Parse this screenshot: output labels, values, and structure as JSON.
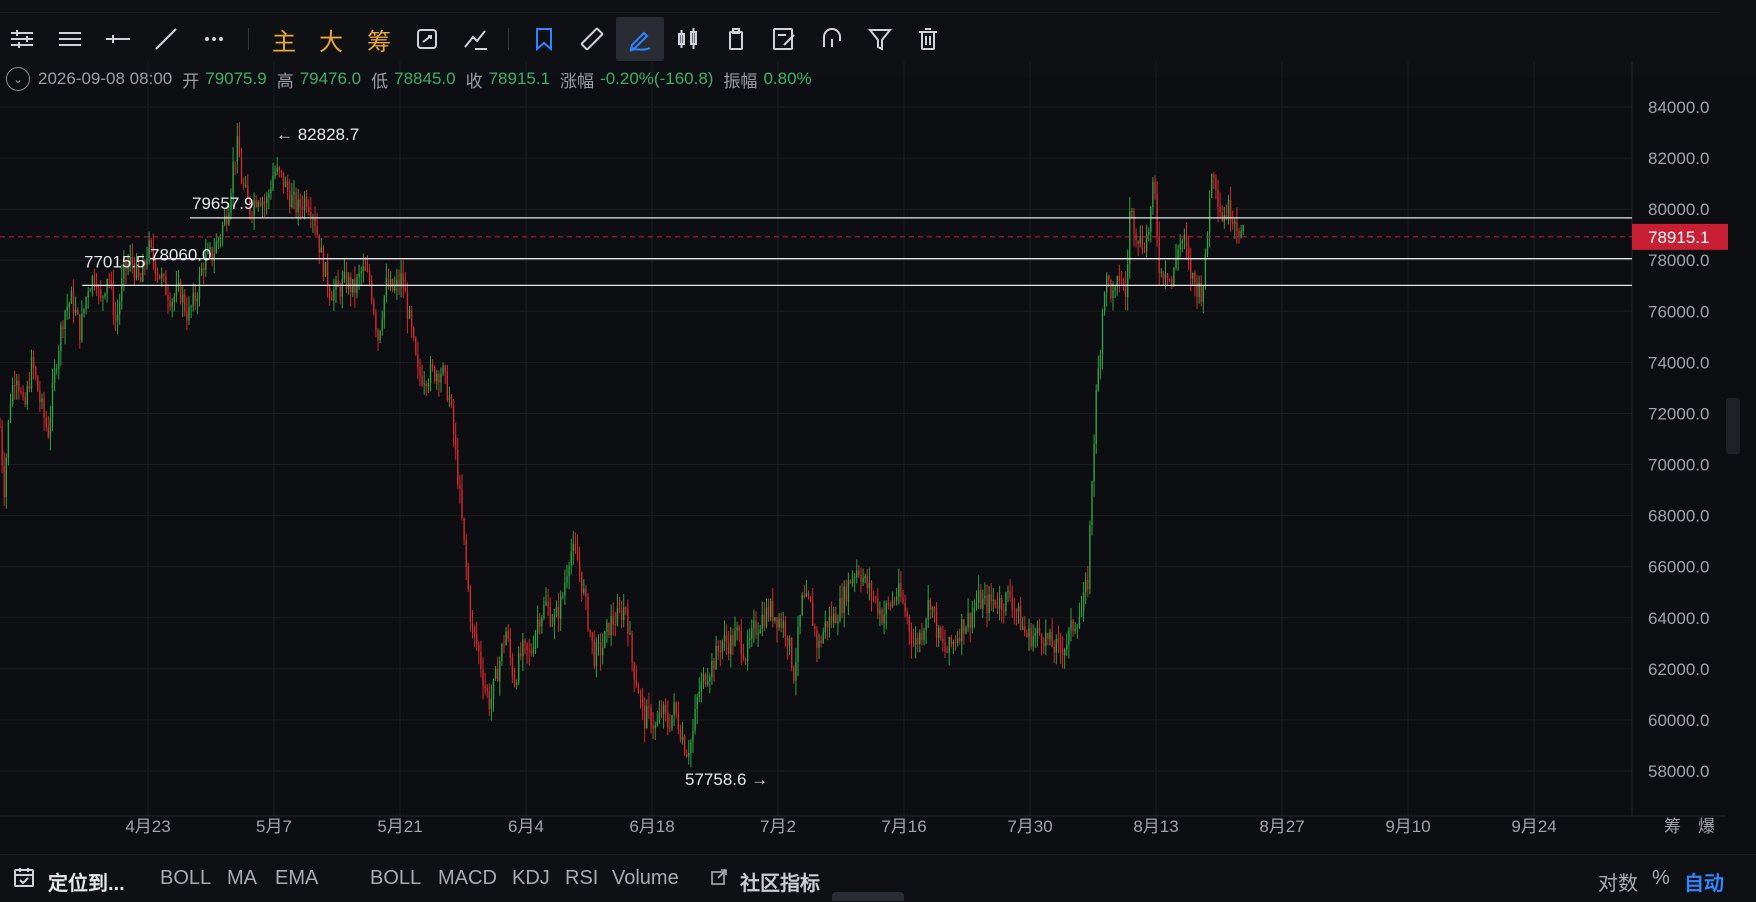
{
  "toolbar": {
    "buttons": [
      {
        "name": "settings-lines-icon"
      },
      {
        "name": "menu-lines-icon"
      },
      {
        "name": "horizontal-line-icon"
      },
      {
        "name": "trend-line-icon"
      },
      {
        "name": "more-dots-icon"
      },
      {
        "label": "主"
      },
      {
        "label": "大"
      },
      {
        "label": "筹"
      },
      {
        "name": "refresh-icon"
      },
      {
        "name": "draw-tools-icon"
      },
      {
        "name": "bookmark-icon"
      },
      {
        "name": "ruler-icon"
      },
      {
        "name": "pen-draw-icon"
      },
      {
        "name": "candles-icon"
      },
      {
        "name": "clipboard-icon"
      },
      {
        "name": "edit-note-icon"
      },
      {
        "name": "magnet-icon"
      },
      {
        "name": "filter-icon"
      },
      {
        "name": "trash-icon"
      }
    ]
  },
  "ohlc": {
    "date": "2026-09-08 08:00",
    "open_label": "开",
    "open": "79075.9",
    "high_label": "高",
    "high": "79476.0",
    "low_label": "低",
    "low": "78845.0",
    "close_label": "收",
    "close": "78915.1",
    "change_label": "涨幅",
    "change": "-0.20%(-160.8)",
    "amp_label": "振幅",
    "amp": "0.80%"
  },
  "chart_data": {
    "type": "candlestick",
    "ylim": [
      57000,
      85000
    ],
    "y_ticks": [
      "84000.0",
      "82000.0",
      "80000.0",
      "78000.0",
      "76000.0",
      "74000.0",
      "72000.0",
      "70000.0",
      "68000.0",
      "66000.0",
      "64000.0",
      "62000.0",
      "60000.0",
      "58000.0"
    ],
    "x_ticks": [
      "4月23",
      "5月7",
      "5月21",
      "6月4",
      "6月18",
      "7月2",
      "7月16",
      "7月30",
      "8月13",
      "8月27",
      "9月10",
      "9月24"
    ],
    "axis_right_extra": [
      "筹",
      "爆"
    ],
    "price_path": [
      [
        0,
        71.5
      ],
      [
        4,
        69
      ],
      [
        10,
        72.5
      ],
      [
        16,
        73.8
      ],
      [
        24,
        72
      ],
      [
        32,
        74
      ],
      [
        40,
        72.5
      ],
      [
        48,
        71.2
      ],
      [
        56,
        74
      ],
      [
        64,
        76
      ],
      [
        72,
        76.5
      ],
      [
        80,
        75.2
      ],
      [
        88,
        77
      ],
      [
        96,
        77.5
      ],
      [
        100,
        76.2
      ],
      [
        108,
        77.6
      ],
      [
        116,
        75.5
      ],
      [
        124,
        77.6
      ],
      [
        132,
        78
      ],
      [
        140,
        77
      ],
      [
        148,
        78.5
      ],
      [
        156,
        77.8
      ],
      [
        164,
        77
      ],
      [
        172,
        76.5
      ],
      [
        180,
        76.8
      ],
      [
        188,
        75.8
      ],
      [
        196,
        76.6
      ],
      [
        204,
        78
      ],
      [
        212,
        78.2
      ],
      [
        220,
        79
      ],
      [
        228,
        80
      ],
      [
        234,
        82
      ],
      [
        238,
        82.5
      ],
      [
        242,
        81
      ],
      [
        250,
        80
      ],
      [
        258,
        80.6
      ],
      [
        266,
        80.2
      ],
      [
        274,
        81.5
      ],
      [
        282,
        81.2
      ],
      [
        290,
        80.5
      ],
      [
        298,
        80
      ],
      [
        306,
        80.5
      ],
      [
        314,
        79.8
      ],
      [
        322,
        78
      ],
      [
        330,
        76.8
      ],
      [
        338,
        76.8
      ],
      [
        346,
        77.2
      ],
      [
        354,
        76.8
      ],
      [
        362,
        77.6
      ],
      [
        370,
        77.2
      ],
      [
        378,
        75
      ],
      [
        386,
        77
      ],
      [
        394,
        76.8
      ],
      [
        402,
        77.3
      ],
      [
        410,
        75.5
      ],
      [
        418,
        73.5
      ],
      [
        426,
        73.5
      ],
      [
        434,
        73.6
      ],
      [
        442,
        73.7
      ],
      [
        450,
        72.5
      ],
      [
        458,
        69.5
      ],
      [
        466,
        66
      ],
      [
        472,
        63.5
      ],
      [
        478,
        62.8
      ],
      [
        484,
        61.5
      ],
      [
        490,
        60.6
      ],
      [
        498,
        62
      ],
      [
        506,
        63.5
      ],
      [
        514,
        61.5
      ],
      [
        522,
        62.7
      ],
      [
        530,
        62.5
      ],
      [
        538,
        64
      ],
      [
        546,
        64.5
      ],
      [
        554,
        63.8
      ],
      [
        562,
        64.7
      ],
      [
        570,
        66.7
      ],
      [
        578,
        66.2
      ],
      [
        586,
        64.4
      ],
      [
        594,
        62.5
      ],
      [
        602,
        62.8
      ],
      [
        610,
        63.8
      ],
      [
        618,
        64
      ],
      [
        626,
        64.5
      ],
      [
        632,
        62.3
      ],
      [
        638,
        61.3
      ],
      [
        644,
        60
      ],
      [
        650,
        60.2
      ],
      [
        656,
        59.6
      ],
      [
        662,
        60.4
      ],
      [
        668,
        59.8
      ],
      [
        674,
        60.4
      ],
      [
        680,
        59.7
      ],
      [
        686,
        58.8
      ],
      [
        692,
        59.2
      ],
      [
        698,
        61
      ],
      [
        706,
        61.8
      ],
      [
        714,
        62.3
      ],
      [
        722,
        63.1
      ],
      [
        730,
        63
      ],
      [
        738,
        63.4
      ],
      [
        746,
        62.5
      ],
      [
        754,
        63.5
      ],
      [
        762,
        64
      ],
      [
        770,
        64.3
      ],
      [
        778,
        64
      ],
      [
        786,
        63.6
      ],
      [
        794,
        61.8
      ],
      [
        802,
        64.6
      ],
      [
        810,
        64.5
      ],
      [
        818,
        62.8
      ],
      [
        826,
        63.8
      ],
      [
        834,
        64
      ],
      [
        842,
        64.6
      ],
      [
        850,
        65.5
      ],
      [
        858,
        66
      ],
      [
        866,
        65.3
      ],
      [
        874,
        64.8
      ],
      [
        882,
        64.1
      ],
      [
        890,
        64.5
      ],
      [
        898,
        65
      ],
      [
        906,
        64.2
      ],
      [
        914,
        62.9
      ],
      [
        922,
        63.5
      ],
      [
        930,
        64.8
      ],
      [
        938,
        63.3
      ],
      [
        946,
        62.6
      ],
      [
        954,
        63.1
      ],
      [
        962,
        63.7
      ],
      [
        970,
        64
      ],
      [
        978,
        64.7
      ],
      [
        986,
        64.5
      ],
      [
        994,
        64.7
      ],
      [
        1002,
        64.6
      ],
      [
        1010,
        64.9
      ],
      [
        1018,
        64.1
      ],
      [
        1026,
        63.3
      ],
      [
        1034,
        63.3
      ],
      [
        1042,
        63.4
      ],
      [
        1050,
        63
      ],
      [
        1058,
        62.7
      ],
      [
        1066,
        63
      ],
      [
        1074,
        63.8
      ],
      [
        1082,
        64.3
      ],
      [
        1088,
        65.5
      ],
      [
        1092,
        69.5
      ],
      [
        1096,
        72.5
      ],
      [
        1100,
        74.5
      ],
      [
        1104,
        77
      ],
      [
        1108,
        77.2
      ],
      [
        1114,
        76.4
      ],
      [
        1120,
        77.5
      ],
      [
        1126,
        76.5
      ],
      [
        1130,
        80
      ],
      [
        1136,
        79.2
      ],
      [
        1142,
        78.6
      ],
      [
        1148,
        79
      ],
      [
        1154,
        81
      ],
      [
        1160,
        77.4
      ],
      [
        1166,
        77.8
      ],
      [
        1172,
        77
      ],
      [
        1178,
        78.6
      ],
      [
        1184,
        78.8
      ],
      [
        1190,
        77.5
      ],
      [
        1196,
        77
      ],
      [
        1202,
        76.8
      ],
      [
        1206,
        78
      ],
      [
        1210,
        81
      ],
      [
        1214,
        81.6
      ],
      [
        1218,
        80.5
      ],
      [
        1222,
        79.7
      ],
      [
        1228,
        80
      ],
      [
        1234,
        79.8
      ],
      [
        1240,
        79.1
      ],
      [
        1244,
        78.9
      ]
    ],
    "annotations": [
      {
        "text": "82828.7",
        "prefix": "←",
        "value": 82828.7
      },
      {
        "text": "57758.6",
        "suffix": "→",
        "value": 57758.6
      }
    ],
    "level_lines": [
      {
        "label": "79657.9",
        "value": 79657.9
      },
      {
        "label": "78060.0",
        "value": 78060.0
      },
      {
        "label": "77015.5",
        "value": 77015.5
      }
    ],
    "last_price": {
      "label": "78915.1",
      "value": 78915.1,
      "color": "#c81f35"
    },
    "colors": {
      "up": "#2ea043",
      "down": "#d1292f",
      "bg": "#0d0e11",
      "grid": "#1b1d21",
      "axis_text": "#a0a3aa"
    }
  },
  "bottombar": {
    "locate": "定位到...",
    "main_indicators": [
      "BOLL",
      "MA",
      "EMA"
    ],
    "sub_indicators": [
      "BOLL",
      "MACD",
      "KDJ",
      "RSI",
      "Volume"
    ],
    "community": "社区指标",
    "log": "对数",
    "percent": "%",
    "auto": "自动"
  }
}
